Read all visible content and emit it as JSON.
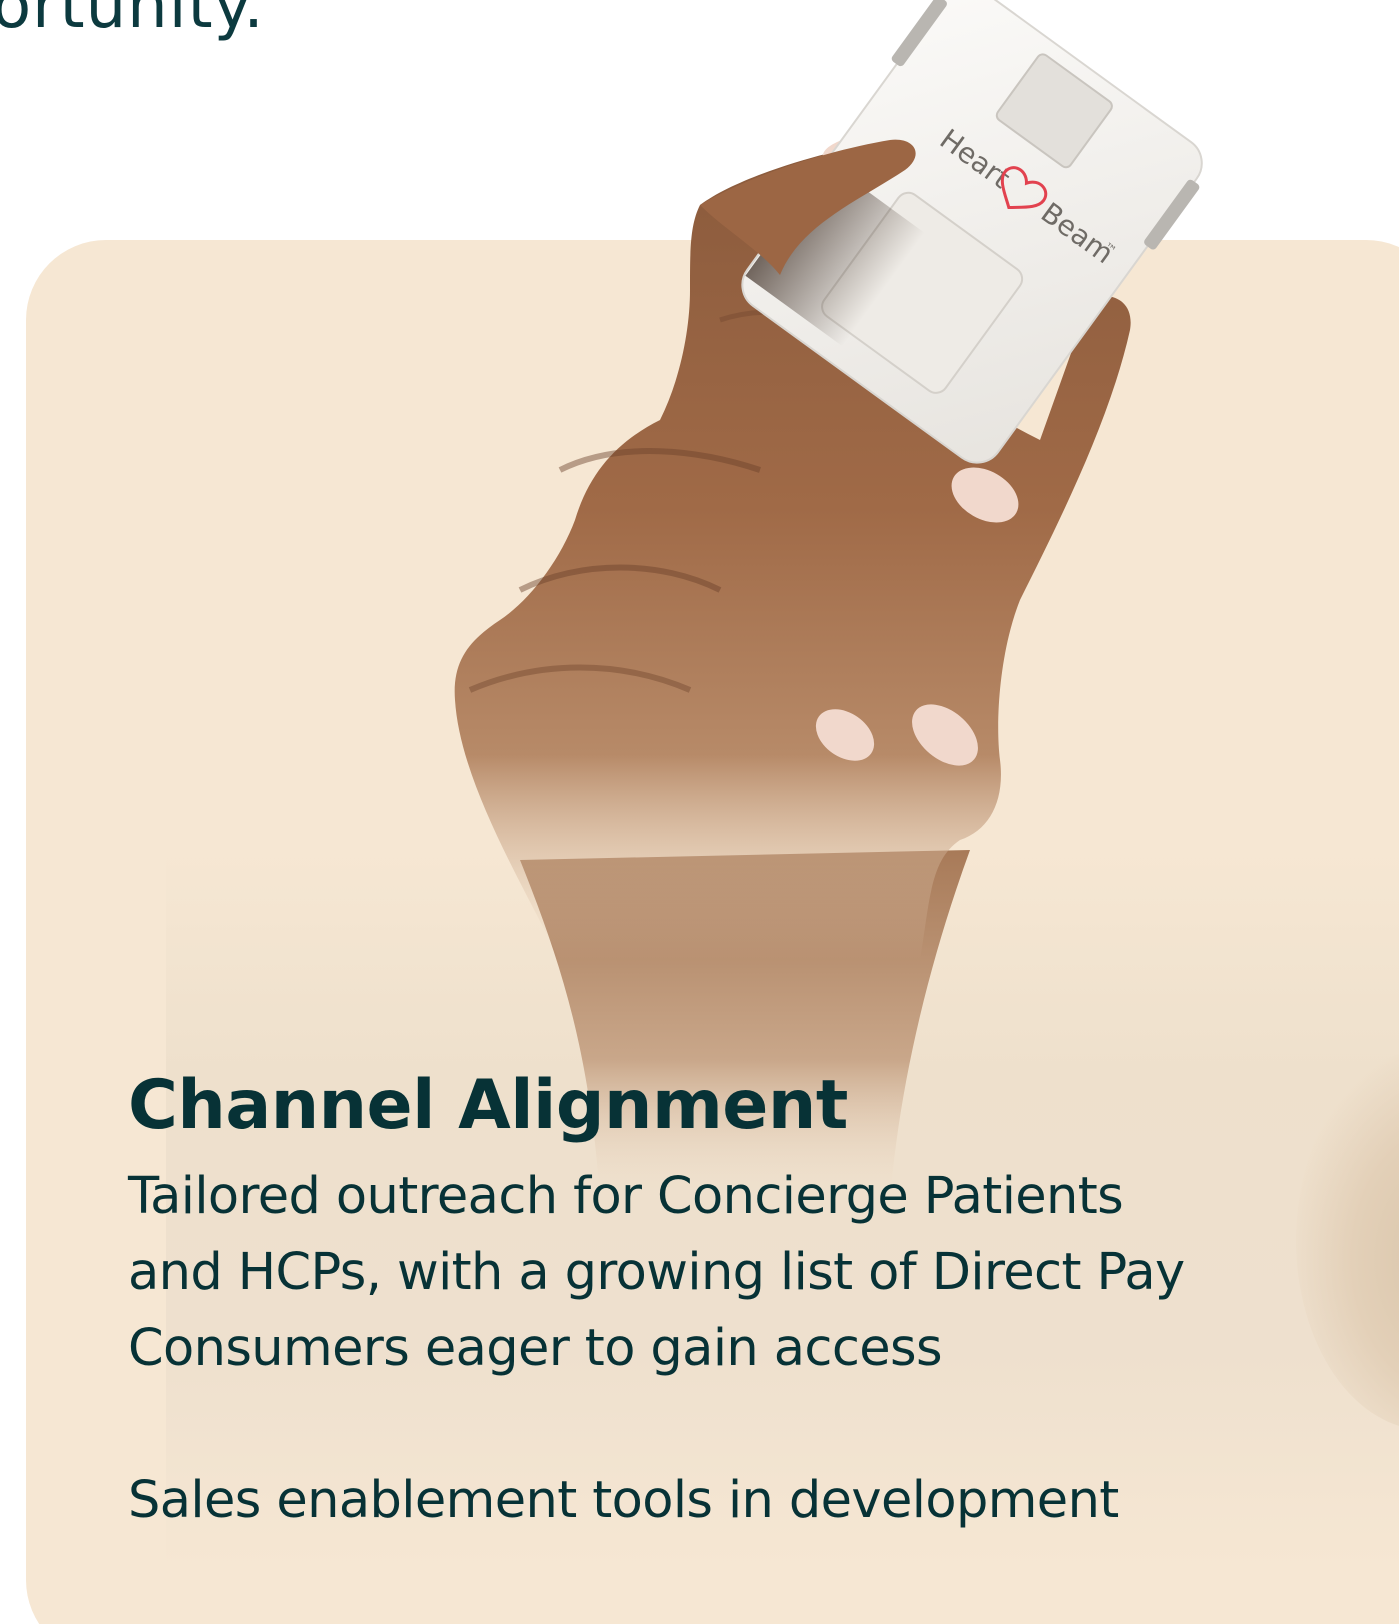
{
  "top_fragment": "ortunity.",
  "card": {
    "title": "Channel Alignment",
    "paragraph_lines": [
      "Tailored outreach for Concierge Patients",
      "and HCPs, with a growing list of Direct Pay",
      "Consumers eager to gain access"
    ],
    "paragraph_2": "Sales enablement tools in development"
  },
  "device": {
    "brand_word_1": "Heart",
    "brand_word_2": "Beam",
    "trademark": "™"
  },
  "colors": {
    "text": "#073236",
    "card_background": "#f6e7d3",
    "page_background": "#ffffff",
    "device": "#f2f0ed",
    "brand_heart": "#e2424f"
  }
}
